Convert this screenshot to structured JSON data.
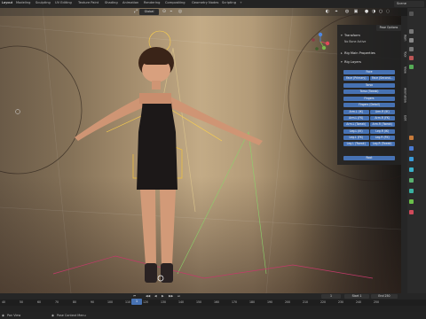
{
  "topbar": {
    "tabs": [
      "Layout",
      "Modeling",
      "Sculpting",
      "UV Editing",
      "Texture Paint",
      "Shading",
      "Animation",
      "Rendering",
      "Compositing",
      "Geometry Nodes",
      "Scripting"
    ],
    "scene_label": "Scene"
  },
  "viewport": {
    "orientation_label": "Global",
    "pose_options_label": "Pose Options"
  },
  "npanel": {
    "transform_header": "Transform",
    "no_bone_text": "No Bone Active",
    "rig_main_header": "Rig Main Properties",
    "rig_layers_header": "Rig Layers",
    "buttons": {
      "face": "Face",
      "face_primary": "Face (Primary)",
      "face_secondary": "Face (Second...",
      "torso": "Torso",
      "torso_tweak": "Torso (Tweak)",
      "fingers": "Fingers",
      "fingers_detail": "Fingers (Detail)",
      "arm_l_ik": "Arm.L (IK)",
      "arm_r_ik": "Arm.R (IK)",
      "arm_l_fk": "Arm.L (FK)",
      "arm_r_fk": "Arm.R (FK)",
      "arm_l_tweak": "Arm.L (Tweak)",
      "arm_r_tweak": "Arm.R (Tweak)",
      "leg_l_ik": "Leg.L (IK)",
      "leg_r_ik": "Leg.R (IK)",
      "leg_l_fk": "Leg.L (FK)",
      "leg_r_fk": "Leg.R (FK)",
      "leg_l_tweak": "Leg.L (Tweak)",
      "leg_r_tweak": "Leg.R (Tweak)",
      "root": "Root"
    }
  },
  "sidetabs": [
    "Item",
    "Tool",
    "View",
    "Animation",
    "Edit"
  ],
  "timeline": {
    "ticks": [
      "40",
      "50",
      "60",
      "70",
      "80",
      "90",
      "100",
      "110",
      "120",
      "130",
      "140",
      "150",
      "160",
      "170",
      "180",
      "190",
      "200",
      "210",
      "220",
      "230",
      "240",
      "250"
    ],
    "current_frame": "1",
    "playhead_label": "1",
    "start_label": "Start",
    "start_value": "1",
    "end_label": "End",
    "end_value": "250"
  },
  "statusbar": {
    "left_text": "Pan View",
    "middle_text": "Pose Context Menu"
  },
  "colors": {
    "accent_blue": "#4772b3",
    "viewport_warm": "#b39b78",
    "panel_bg": "#232323"
  }
}
